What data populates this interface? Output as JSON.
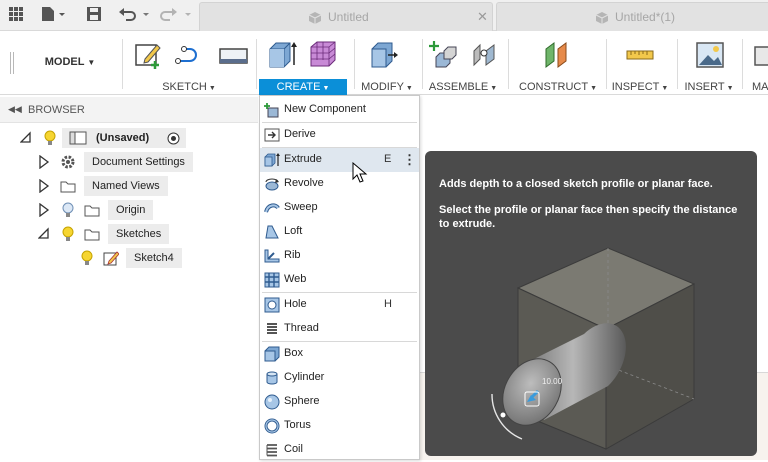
{
  "titlebar": {
    "tabs": [
      {
        "label": "Untitled"
      },
      {
        "label": "Untitled*(1)"
      }
    ]
  },
  "toolbar": {
    "workspace": "MODEL",
    "groups": {
      "sketch": "SKETCH",
      "create": "CREATE",
      "modify": "MODIFY",
      "assemble": "ASSEMBLE",
      "construct": "CONSTRUCT",
      "inspect": "INSPECT",
      "insert": "INSERT",
      "overflow": "MA"
    }
  },
  "browser": {
    "title": "BROWSER",
    "tree": {
      "root": "(Unsaved)",
      "document_settings": "Document Settings",
      "named_views": "Named Views",
      "origin": "Origin",
      "sketches": "Sketches",
      "sketch4": "Sketch4"
    }
  },
  "create_menu": {
    "new_component": "New Component",
    "derive": "Derive",
    "extrude": "Extrude",
    "extrude_key": "E",
    "revolve": "Revolve",
    "sweep": "Sweep",
    "loft": "Loft",
    "rib": "Rib",
    "web": "Web",
    "hole": "Hole",
    "hole_key": "H",
    "thread": "Thread",
    "box": "Box",
    "cylinder": "Cylinder",
    "sphere": "Sphere",
    "torus": "Torus",
    "coil": "Coil"
  },
  "tooltip": {
    "title": "Adds depth to a closed sketch profile or planar face.",
    "body": "Select the profile or planar face then specify the distance to extrude.",
    "dimension_value": "10.00"
  },
  "colors": {
    "accent": "#0b8fd8",
    "tooltip_bg": "#4b4b4b",
    "menu_highlight": "#dfe7ef"
  }
}
